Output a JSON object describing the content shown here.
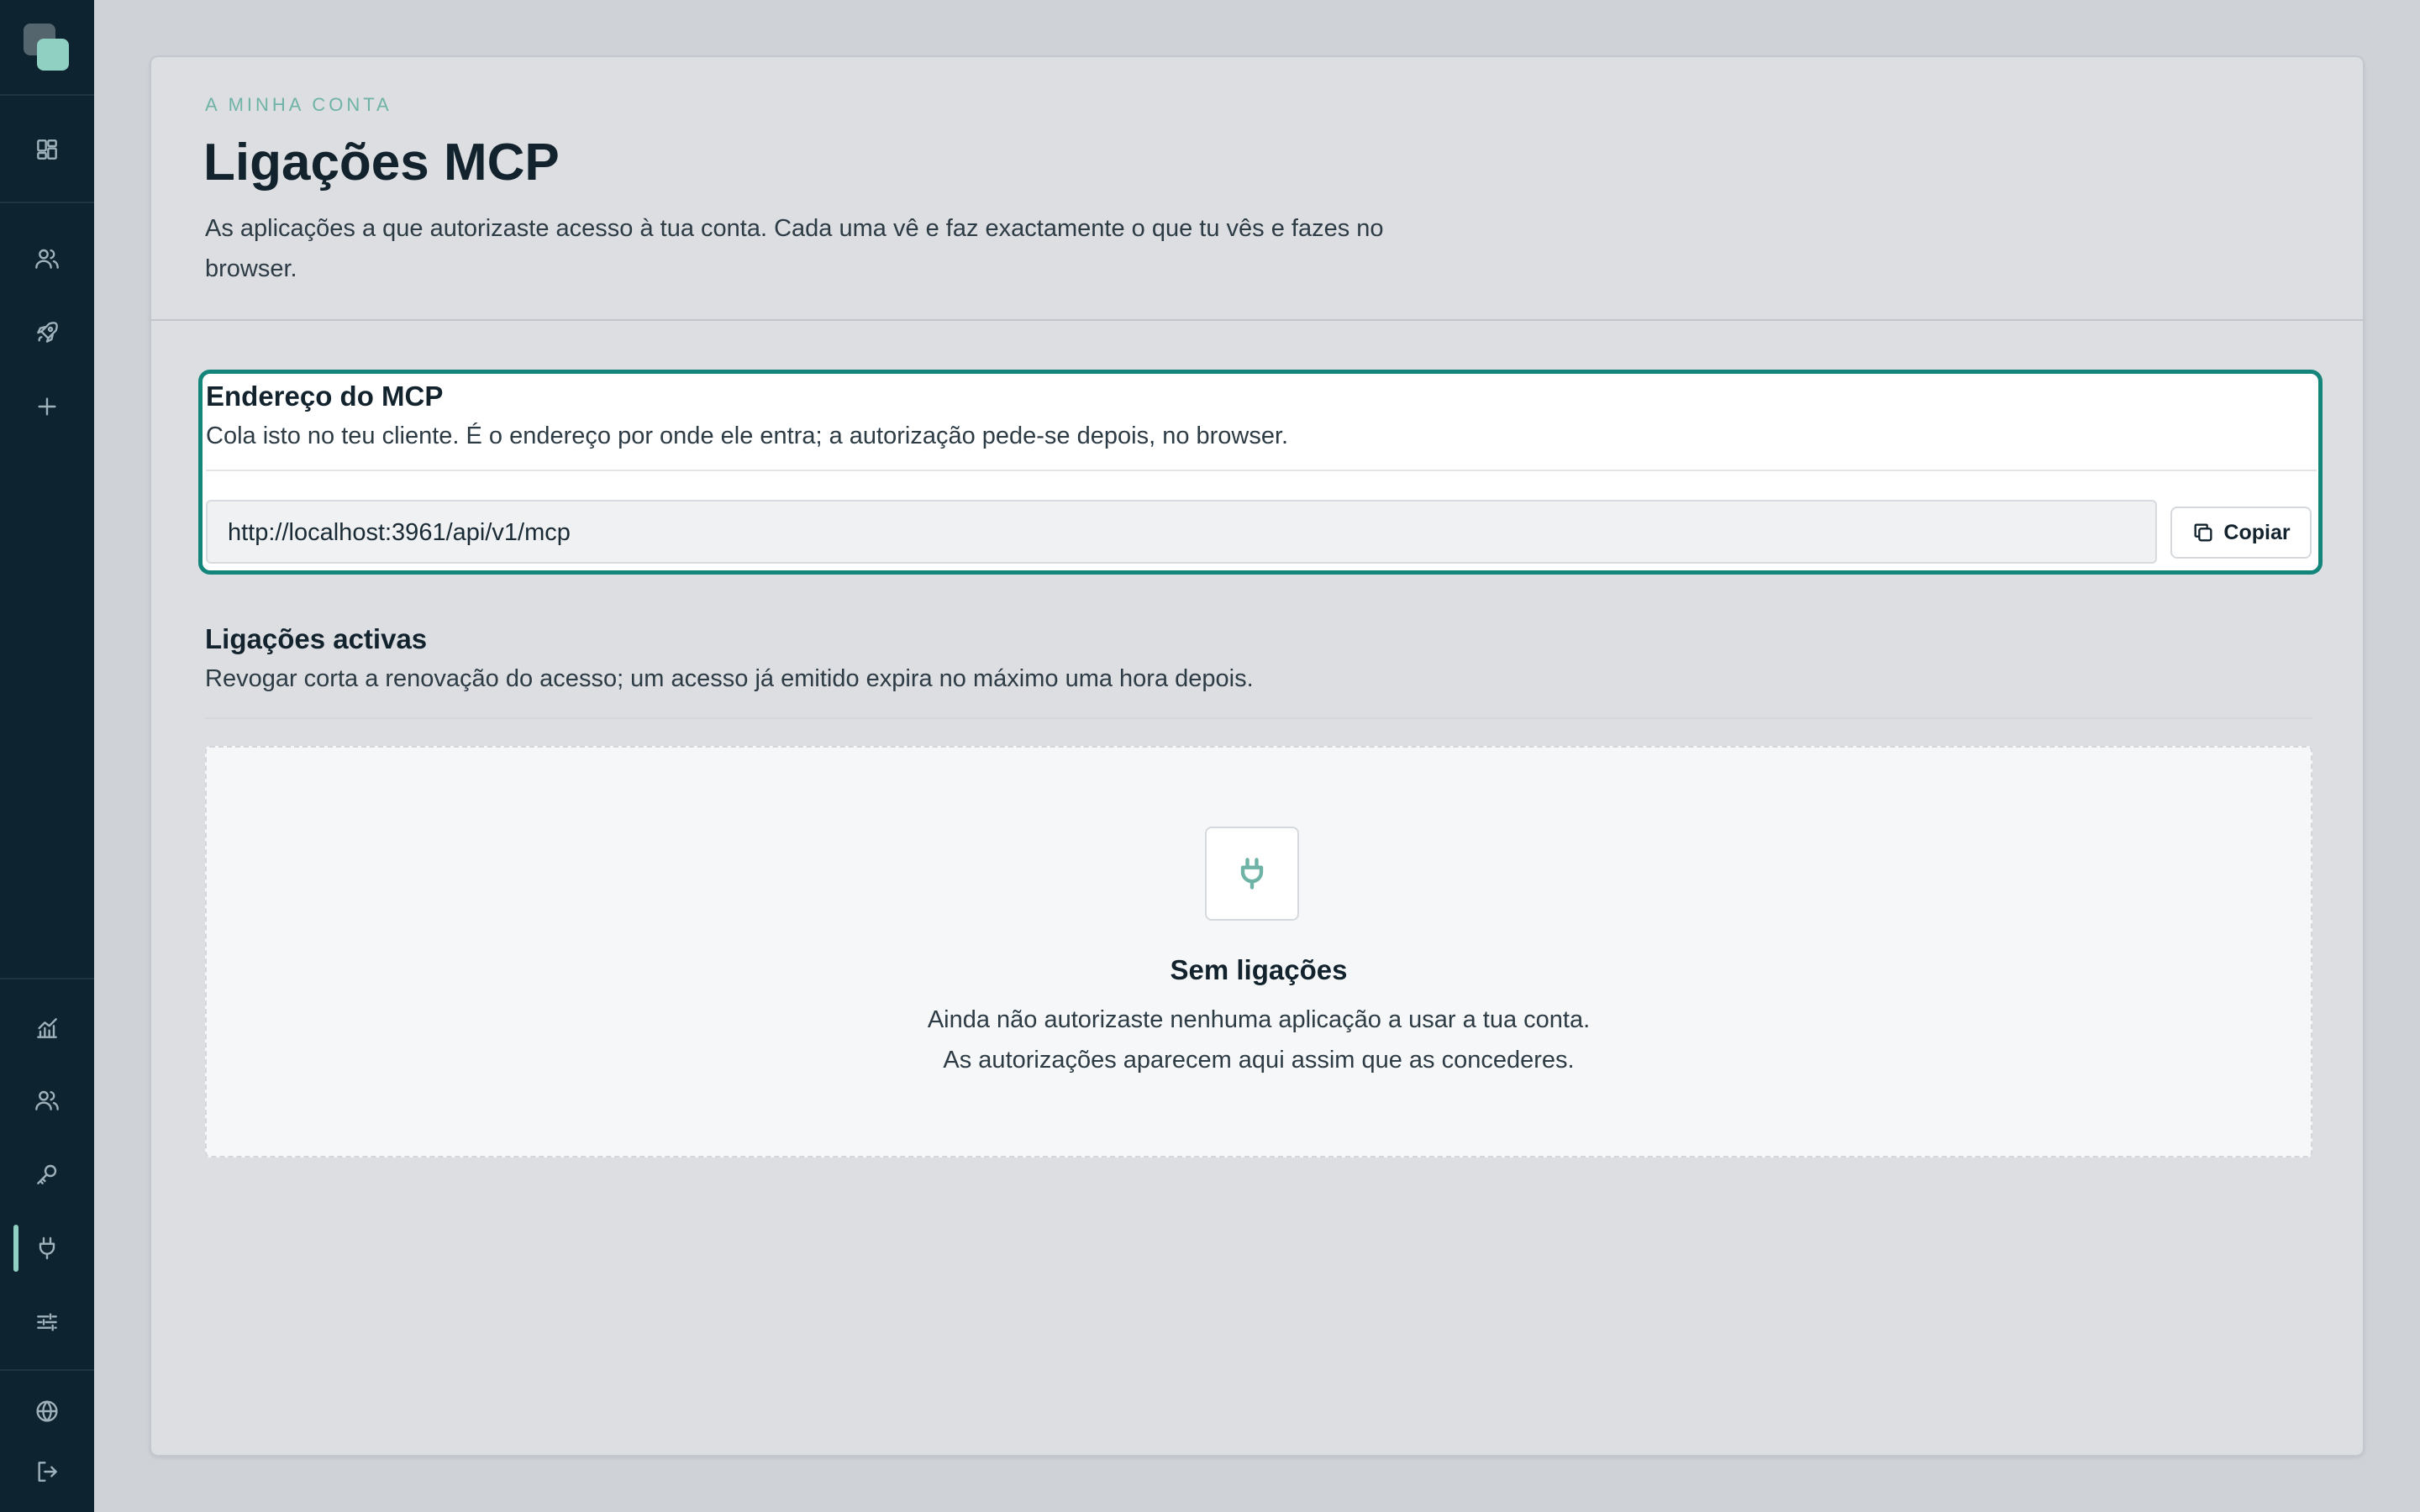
{
  "sidebar": {
    "top_items": [
      {
        "icon": "dashboard-icon"
      },
      {
        "icon": "users-icon"
      },
      {
        "icon": "rocket-icon"
      },
      {
        "icon": "plus-icon"
      }
    ],
    "bottom_items": [
      {
        "icon": "chart-icon"
      },
      {
        "icon": "team-icon"
      },
      {
        "icon": "key-icon"
      },
      {
        "icon": "plug-icon",
        "active": true
      },
      {
        "icon": "sliders-icon"
      }
    ],
    "footer_items": [
      {
        "icon": "globe-icon"
      },
      {
        "icon": "logout-icon"
      }
    ],
    "accent_color": "#8fd0c3"
  },
  "header": {
    "eyebrow": "A MINHA CONTA",
    "title": "Ligações MCP",
    "description": "As aplicações a que autorizaste acesso à tua conta. Cada uma vê e faz exactamente o que tu vês e fazes no browser."
  },
  "mcp_address": {
    "title": "Endereço do MCP",
    "description": "Cola isto no teu cliente. É o endereço por onde ele entra; a autorização pede-se depois, no browser.",
    "url": "http://localhost:3961/api/v1/mcp",
    "copy_label": "Copiar",
    "focus_color": "#14857a"
  },
  "active_connections": {
    "title": "Ligações activas",
    "description": "Revogar corta a renovação do acesso; um acesso já emitido expira no máximo uma hora depois.",
    "empty_state": {
      "icon": "plug-icon",
      "title": "Sem ligações",
      "description": "Ainda não autorizaste nenhuma aplicação a usar a tua conta. As autorizações aparecem aqui assim que as concederes."
    }
  }
}
